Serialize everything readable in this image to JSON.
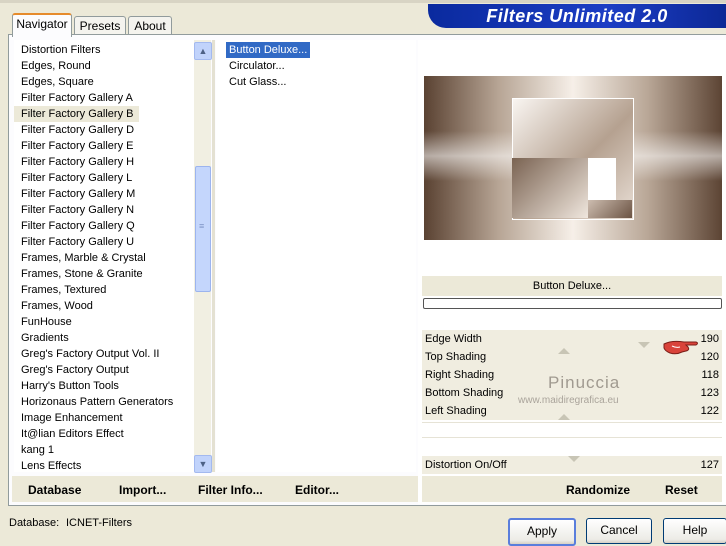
{
  "banner": {
    "title": "Filters Unlimited 2.0"
  },
  "tabs": [
    {
      "label": "Navigator",
      "active": true
    },
    {
      "label": "Presets",
      "active": false
    },
    {
      "label": "About",
      "active": false
    }
  ],
  "categories": {
    "selected": "Filter Factory Gallery B",
    "items": [
      "Distortion Filters",
      "Edges, Round",
      "Edges, Square",
      "Filter Factory Gallery A",
      "Filter Factory Gallery B",
      "Filter Factory Gallery D",
      "Filter Factory Gallery E",
      "Filter Factory Gallery H",
      "Filter Factory Gallery L",
      "Filter Factory Gallery M",
      "Filter Factory Gallery N",
      "Filter Factory Gallery Q",
      "Filter Factory Gallery U",
      "Frames, Marble & Crystal",
      "Frames, Stone & Granite",
      "Frames, Textured",
      "Frames, Wood",
      "FunHouse",
      "Gradients",
      "Greg's Factory Output Vol. II",
      "Greg's Factory Output",
      "Harry's Button Tools",
      "Horizonaus Pattern Generators",
      "Image Enhancement",
      "It@lian Editors Effect",
      "kang 1",
      "Lens Effects"
    ]
  },
  "filters": {
    "selected": "Button Deluxe...",
    "items": [
      "Button Deluxe...",
      "Circulator...",
      "Cut Glass..."
    ]
  },
  "preview": {
    "filter_name": "Button Deluxe..."
  },
  "sliders": [
    {
      "label": "Edge Width",
      "value": "190"
    },
    {
      "label": "Top Shading",
      "value": "120"
    },
    {
      "label": "Right Shading",
      "value": "118"
    },
    {
      "label": "Bottom Shading",
      "value": "123"
    },
    {
      "label": "Left Shading",
      "value": "122"
    },
    {
      "label": "Distortion On/Off",
      "value": "127"
    }
  ],
  "watermark": {
    "name": "Pinuccia",
    "url": "www.maidiregrafica.eu"
  },
  "left_buttons": {
    "database": "Database",
    "import": "Import...",
    "filter_info": "Filter Info...",
    "editor": "Editor..."
  },
  "right_buttons": {
    "randomize": "Randomize",
    "reset": "Reset"
  },
  "status": {
    "database_label": "Database:",
    "database_value": "ICNET-Filters"
  },
  "dialog_buttons": {
    "apply": "Apply",
    "cancel": "Cancel",
    "help": "Help"
  },
  "icons": {
    "scroll_up": "▲",
    "scroll_down": "▼",
    "thumb_grip": "≡"
  },
  "colors": {
    "selection": "#316ac5",
    "banner": "#1c3dc4",
    "tab_accent": "#e68b2c"
  }
}
